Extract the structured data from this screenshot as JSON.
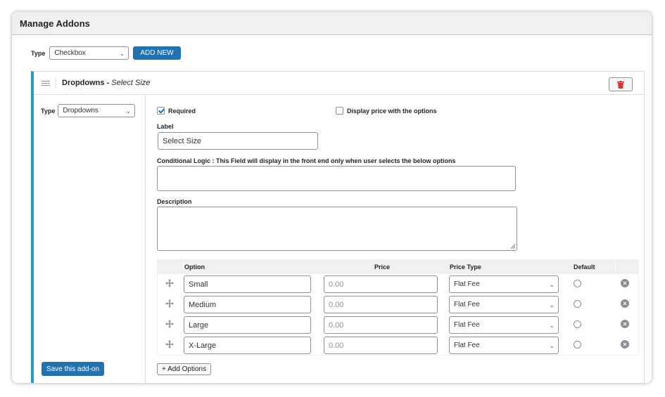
{
  "panel": {
    "title": "Manage Addons"
  },
  "topbar": {
    "type_label": "Type",
    "type_value": "Checkbox",
    "add_new_label": "ADD NEW"
  },
  "addon": {
    "title_bold": "Dropdowns -",
    "title_italic": "Select Size",
    "left_type_label": "Type",
    "left_type_value": "Dropdowns",
    "save_label": "Save this add-on",
    "required_label": "Required",
    "required_checked": true,
    "display_price_label": "Display price with the options",
    "display_price_checked": false,
    "label_title": "Label",
    "label_value": "Select Size",
    "conditional_title": "Conditional Logic : This Field will display in the front end only when user selects the below options",
    "conditional_value": "",
    "description_title": "Description",
    "description_value": "",
    "options_headers": {
      "option": "Option",
      "price": "Price",
      "price_type": "Price Type",
      "default": "Default"
    },
    "options": [
      {
        "name": "Small",
        "price_placeholder": "0.00",
        "price_type": "Flat Fee"
      },
      {
        "name": "Medium",
        "price_placeholder": "0.00",
        "price_type": "Flat Fee"
      },
      {
        "name": "Large",
        "price_placeholder": "0.00",
        "price_type": "Flat Fee"
      },
      {
        "name": "X-Large",
        "price_placeholder": "0.00",
        "price_type": "Flat Fee"
      }
    ],
    "add_options_label": "+ Add Options"
  },
  "colors": {
    "accent": "#2271b1",
    "addon_border": "#2d9bb5",
    "trash": "#d63638"
  },
  "icons": [
    "hamburger-icon",
    "trash-icon",
    "chevron-down-icon",
    "drag-move-icon",
    "remove-circle-icon"
  ]
}
